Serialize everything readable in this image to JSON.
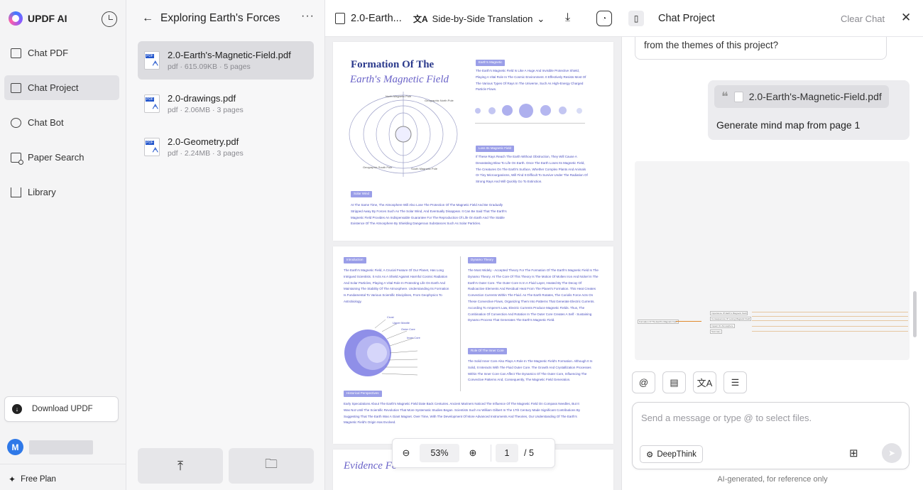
{
  "sidebar": {
    "app_name": "UPDF AI",
    "items": [
      {
        "label": "Chat PDF",
        "icon": "chat-pdf-icon"
      },
      {
        "label": "Chat Project",
        "icon": "folder-icon",
        "active": true
      },
      {
        "label": "Chat Bot",
        "icon": "bot-icon"
      },
      {
        "label": "Paper Search",
        "icon": "search-doc-icon"
      },
      {
        "label": "Library",
        "icon": "library-icon"
      }
    ],
    "download_label": "Download UPDF",
    "avatar_initial": "M",
    "plan_label": "Free Plan"
  },
  "files": {
    "title": "Exploring Earth's Forces",
    "list": [
      {
        "name": "2.0-Earth's-Magnetic-Field.pdf",
        "meta": "pdf · 615.09KB · 5 pages",
        "active": true
      },
      {
        "name": "2.0-drawings.pdf",
        "meta": "pdf · 2.06MB · 3 pages"
      },
      {
        "name": "2.0-Geometry.pdf",
        "meta": "pdf · 2.24MB · 3 pages"
      }
    ]
  },
  "viewer": {
    "doc_title": "2.0-Earth...",
    "translation_mode": "Side-by-Side Translation",
    "page1": {
      "title_line1": "Formation Of The",
      "title_line2": "Earth's Magnetic Field",
      "chip_magnetic": "Earth's Magnetic",
      "chip_loss": "Loss Its Magnetic Field",
      "chip_solar": "Solar Wind",
      "text_magnetic": "The Earth's Magnetic Field Is Like A Huge And Invisible Protective Shield, Playing A Vital Role In The Cosmic Environment. It Effectively Resists Most Of The Various Types Of Rays In The Universe, Such As High-Energy Charged Particle Flows.",
      "text_loss": "If These Rays Reach The Earth Without Obstruction, They Will Cause A Devastating Blow To Life On Earth. Once The Earth Loses Its Magnetic Field, The Creatures On The Earth's Surface, Whether Complex Plants And Animals Or Tiny Microorganisms, Will Find It Difficult To Survive Under The Radiation Of Strong Rays And Will Quickly Go To Extinction.",
      "text_solar": "At The Same Time, The Atmosphere Will Also Lose The Protection Of The Magnetic Field And Be Gradually Stripped Away By Forces Such As The Solar Wind, And Eventually Disappear. It Can Be Said That The Earth's Magnetic Field Provides An Indispensable Guarantee For The Reproduction Of Life On Earth And The Stable Existence Of The Atmosphere By Shielding Dangerous Substances Such As Solar Particles."
    },
    "page2": {
      "chip_intro": "Introduction",
      "chip_dynamo": "Dynamo Theory",
      "chip_inner": "Role Of The Inner Core",
      "chip_history": "Historical Perspectives",
      "text_intro": "The Earth's Magnetic Field, A Crucial Feature Of Our Planet, Has Long Intrigued Scientists. It Acts As A Shield Against Harmful Cosmic Radiation And Solar Particles, Playing A Vital Role In Protecting Life On Earth And Maintaining The Stability Of The Atmosphere. Understanding Its Formation Is Fundamental To Various Scientific Disciplines, From Geophysics To Astrobiology.",
      "text_dynamo": "The Most Widely - Accepted Theory For The Formation Of The Earth's Magnetic Field Is The Dynamo Theory. At The Core Of This Theory Is The Motion Of Molten Iron And Nickel In The Earth's Outer Core. The Outer Core Is In A Fluid Layer, Heated By The Decay Of Radioactive Elements And Residual Heat From The Planet's Formation. This Heat Creates Convection Currents Within The Fluid. As The Earth Rotates, The Coriolis Force Acts On These Convective Flows, Organizing Them Into Patterns That Generate Electric Currents. According To Ampere's Law, Electric Currents Produce Magnetic Fields. Thus, The Combination Of Convection And Rotation In The Outer Core Creates A Self - Sustaining Dynamo Process That Generates The Earth's Magnetic Field.",
      "text_inner": "The Solid Inner Core Also Plays A Role In The Magnetic Field's Formation. Although It Is Solid, It Interacts With The Fluid Outer Core. The Growth And Crystallization Processes Within The Inner Core Can Affect The Dynamics Of The Outer Core, Influencing The Convective Patterns And, Consequently, The Magnetic Field Generation.",
      "text_history": "Early Speculations About The Earth's Magnetic Field Date Back Centuries. Ancient Mariners Noticed The Influence Of The Magnetic Field On Compass Needles, But It Was Not Until The Scientific Revolution That More Systematic Studies Began. Scientists Such As William Gilbert In The 17th Century Made Significant Contributions By Suggesting That The Earth Was A Giant Magnet. Over Time, With The Development Of More Advanced Instruments And Theories, Our Understanding Of The Earth's Magnetic Field's Origin Has Evolved.",
      "layer_labels": [
        "Crust",
        "Upper Mantle",
        "Outer Core",
        "Inner Core"
      ]
    },
    "page3": {
      "title": "Evidence Fo"
    },
    "zoom": "53%",
    "page_current": "1",
    "page_total": "5"
  },
  "chat": {
    "title": "Chat Project",
    "clear_label": "Clear Chat",
    "prev_message_tail": "from the themes of this project?",
    "user_message": {
      "quote_file": "2.0-Earth's-Magnetic-Field.pdf",
      "text": "Generate mind map from page 1"
    },
    "mindmap": {
      "root": "Formation Of The Earth's Magnetic Field",
      "branches": [
        "Importance Of Earth's Magnetic Field",
        "Consequences Of Losing Magnetic Field",
        "Impact On Atmosphere",
        "Summary"
      ]
    },
    "input_placeholder": "Send a message or type @ to select files.",
    "deepthink_label": "DeepThink",
    "footer": "AI-generated, for reference only"
  }
}
